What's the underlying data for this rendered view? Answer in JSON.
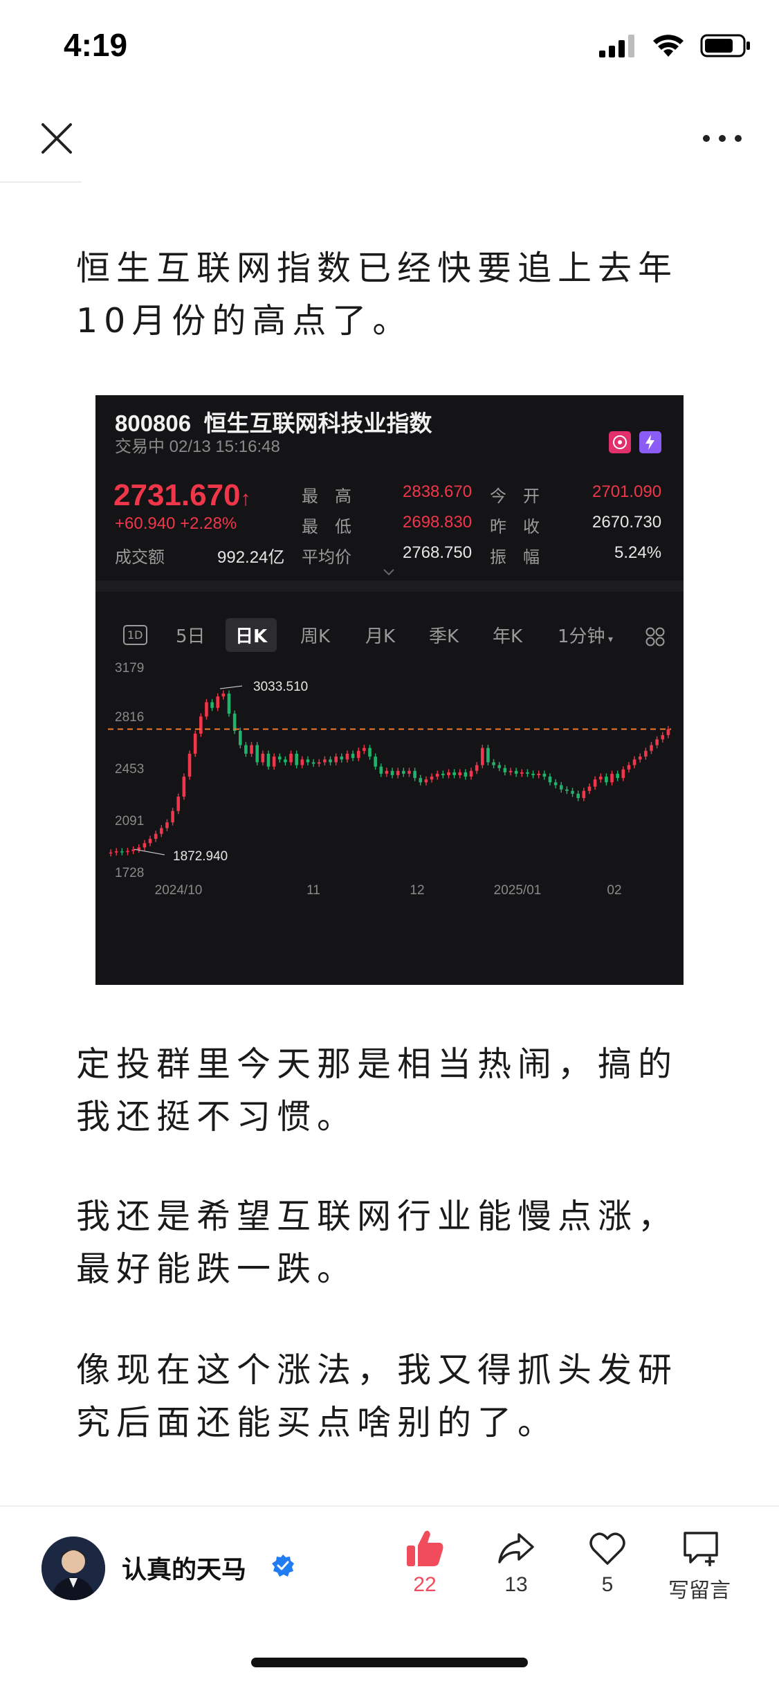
{
  "status_bar": {
    "time": "4:19"
  },
  "nav": {
    "close_icon": "close-icon",
    "more_icon": "more-icon"
  },
  "article": {
    "paragraphs": [
      "恒生互联网指数已经快要追上去年10月份的高点了。",
      "定投群里今天那是相当热闹，搞的我还挺不习惯。",
      "我还是希望互联网行业能慢点涨，最好能跌一跌。",
      "像现在这个涨法，我又得抓头发研究后面还能买点啥别的了。"
    ]
  },
  "quote": {
    "code": "800806",
    "name": "恒生互联网科技业指数",
    "status": "交易中 02/13 15:16:48",
    "price": "2731.670",
    "arrow": "↑",
    "change": "+60.940",
    "change_pct": "+2.28%",
    "high_label": "最　高",
    "high": "2838.670",
    "open_label": "今　开",
    "open": "2701.090",
    "low_label": "最　低",
    "low": "2698.830",
    "prev_close_label": "昨　收",
    "prev_close": "2670.730",
    "turnover_label": "成交额",
    "turnover": "992.24亿",
    "avg_label": "平均价",
    "avg": "2768.750",
    "amplitude_label": "振　幅",
    "amplitude": "5.24%",
    "colors": {
      "up": "#f0364a",
      "down": "#21b36b",
      "background": "#141416"
    }
  },
  "chart_tabs": {
    "items": [
      "1D",
      "5日",
      "日K",
      "周K",
      "月K",
      "季K",
      "年K",
      "1分钟"
    ],
    "active": "日K",
    "grid_icon": "grid-icon"
  },
  "chart_data": {
    "type": "candlestick",
    "title": "",
    "y_ticks": [
      "3179",
      "2816",
      "2453",
      "2091",
      "1728"
    ],
    "ylim": [
      1728,
      3179
    ],
    "x_ticks": [
      "2024/10",
      "11",
      "12",
      "2025/01",
      "02"
    ],
    "reference_line": 2731.67,
    "annotations": [
      {
        "label": "3033.510",
        "value": 3033.51
      },
      {
        "label": "1872.940",
        "value": 1872.94
      }
    ],
    "close_series": [
      1870,
      1878,
      1872,
      1880,
      1890,
      1905,
      1935,
      1965,
      2000,
      2040,
      2080,
      2160,
      2260,
      2400,
      2560,
      2700,
      2820,
      2920,
      2880,
      2960,
      2980,
      2840,
      2720,
      2620,
      2560,
      2620,
      2500,
      2560,
      2470,
      2540,
      2520,
      2500,
      2560,
      2480,
      2520,
      2500,
      2490,
      2500,
      2520,
      2500,
      2540,
      2520,
      2560,
      2530,
      2580,
      2600,
      2540,
      2470,
      2420,
      2440,
      2410,
      2440,
      2420,
      2440,
      2390,
      2360,
      2380,
      2400,
      2420,
      2410,
      2430,
      2410,
      2430,
      2400,
      2440,
      2480,
      2600,
      2500,
      2480,
      2460,
      2430,
      2440,
      2420,
      2430,
      2420,
      2410,
      2420,
      2400,
      2360,
      2340,
      2310,
      2300,
      2280,
      2250,
      2300,
      2330,
      2380,
      2400,
      2360,
      2420,
      2390,
      2450,
      2480,
      2520,
      2540,
      2580,
      2620,
      2660,
      2690,
      2731.67
    ]
  },
  "author": {
    "name": "认真的天马",
    "verified_icon": "verified-icon",
    "avatar_icon": "avatar"
  },
  "actions": {
    "like": {
      "icon": "thumbs-up-icon",
      "count": "22",
      "color": "#f04c5c"
    },
    "share": {
      "icon": "share-icon",
      "count": "13"
    },
    "favorite": {
      "icon": "heart-icon",
      "count": "5"
    },
    "comment": {
      "icon": "comment-add-icon",
      "label": "写留言"
    }
  }
}
